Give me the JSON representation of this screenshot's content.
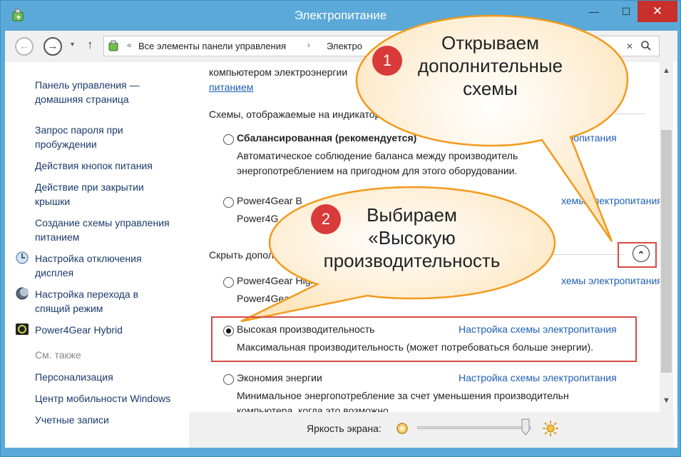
{
  "window": {
    "title": "Электропитание",
    "minimize": "—",
    "maximize": "☐",
    "close": "✕"
  },
  "navbar": {
    "back": "←",
    "forward": "→",
    "history": "▾",
    "up": "↑",
    "address_sep": "«",
    "address_crumb1": "Все элементы панели управления",
    "address_sep2": "›",
    "address_crumb2": "Электро",
    "search_clear": "✕"
  },
  "sidebar": {
    "home": "Панель управления —\nдомашняя страница",
    "links": [
      "Запрос пароля при\nпробуждении",
      "Действия кнопок питания",
      "Действие при закрытии\nкрышки",
      "Создание схемы управления\nпитанием",
      "Настройка отключения\nдисплея",
      "Настройка перехода в\nспящий режим",
      "Power4Gear Hybrid"
    ],
    "see_also": "См. также",
    "see_also_links": [
      "Персонализация",
      "Центр мобильности Windows",
      "Учетные записи"
    ]
  },
  "main": {
    "top_text": "компьютером электроэнергии",
    "top_link": "питанием",
    "section_title": "Схемы, отображаемые на индикаторе батар",
    "plans": [
      {
        "name": "Сбалансированная (рекомендуется)",
        "link": "Настройка схемы электропитания",
        "desc1": "Автоматическое соблюдение баланса между производитель",
        "desc2": "энергопотреблением на пригодном для этого оборудовании.",
        "checked": false
      },
      {
        "name": "Power4Gear B",
        "link": "хемы электропитания",
        "desc1": "Power4G",
        "checked": false
      }
    ],
    "hide_title": "Скрыть допол",
    "extra_plans": [
      {
        "name": "Power4Gear High",
        "link": "хемы электропитания",
        "desc1": "Power4Gear",
        "checked": false
      },
      {
        "name": "Высокая производительность",
        "link": "Настройка схемы электропитания",
        "desc1": "Максимальная производительность (может потребоваться больше энергии).",
        "checked": true
      },
      {
        "name": "Экономия энергии",
        "link": "Настройка схемы электропитания",
        "desc1": "Минимальное энергопотребление за счет уменьшения производительн",
        "desc2": "компьютера, когда это возможно.",
        "checked": false
      }
    ],
    "collapse_icon": "⌃"
  },
  "scrollbar": {
    "up": "▲",
    "down": "▼"
  },
  "bottom": {
    "brightness_label": "Яркость экрана:",
    "brightness_level": 0.95
  },
  "annotations": {
    "badge1": "1",
    "bubble1": "Открываем\nдополнительные\nсхемы",
    "badge2": "2",
    "bubble2": "Выбираем\n«Высокую\nпроизводительность"
  },
  "colors": {
    "titlebar": "#5aa9d8",
    "link": "#1e5fb4",
    "callout_fill": "#fff3dc",
    "callout_stroke": "#f29a1c",
    "badge": "#d93a3a",
    "highlight": "#d64a44"
  }
}
